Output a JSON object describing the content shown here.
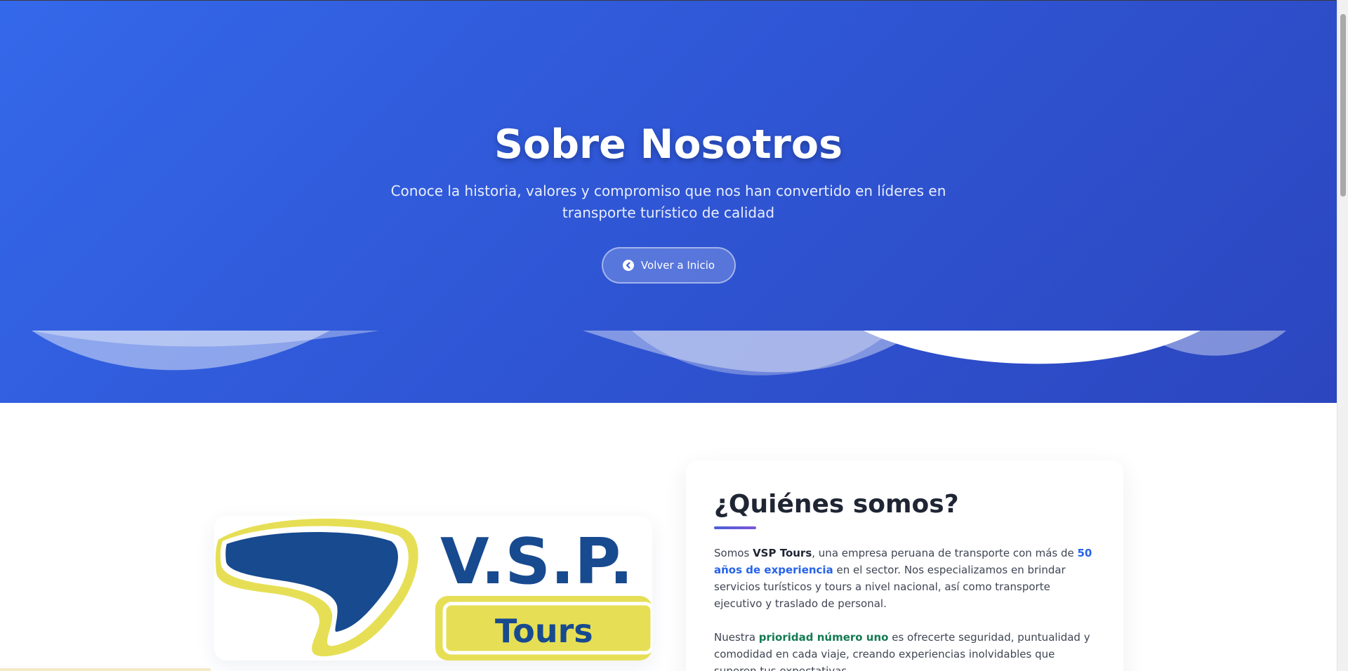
{
  "hero": {
    "title": "Sobre Nosotros",
    "subtitle": "Conoce la historia, valores y compromiso que nos han convertido en líderes en transporte turístico de calidad",
    "button_label": "Volver a Inicio",
    "button_icon": "chevron-left-circle-icon",
    "gradient_start": "#3468ea",
    "gradient_end": "#2c46bf"
  },
  "logo": {
    "text_main": "V.S.P.",
    "text_sub": "Tours",
    "color_blue": "#174a8f",
    "color_yellow": "#e6df55"
  },
  "about": {
    "title": "¿Quiénes somos?",
    "p1": {
      "t1": "Somos ",
      "brand": "VSP Tours",
      "t2": ", una empresa peruana de transporte con más de ",
      "highlight": "50 años de experiencia",
      "t3": " en el sector. Nos especializamos en brindar servicios turísticos y tours a nivel nacional, así como transporte ejecutivo y traslado de personal."
    },
    "p2": {
      "t1": "Nuestra ",
      "highlight": "prioridad número uno",
      "t2": " es ofrecerte seguridad, puntualidad y comodidad en cada viaje, creando experiencias inolvidables que superen tus expectativas."
    },
    "accent_blue": "#2563eb",
    "accent_green": "#137a52"
  }
}
